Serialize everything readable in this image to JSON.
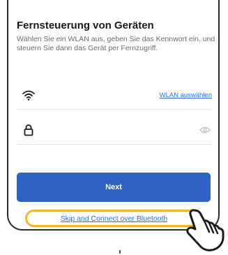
{
  "dialog": {
    "title": "Fernsteuerung von Geräten",
    "description": "Wählen Sie ein WLAN aus, geben Sie das Kennwort ein, und steuern Sie dann das Gerät per Fernzugriff.",
    "wifi_row": {
      "icon": "wifi-icon",
      "link_label": "WLAN auswählen"
    },
    "password_row": {
      "icon": "lock-icon",
      "visibility_icon": "eye-icon"
    },
    "next_label": "Next",
    "skip_label": "Skip and Connect over Bluetooth"
  },
  "overlay": {
    "highlight_color": "#f0b62c",
    "pointer": "pointing-hand-icon"
  },
  "colors": {
    "primary_button": "#2e63c4",
    "link": "#2f6fd6"
  }
}
